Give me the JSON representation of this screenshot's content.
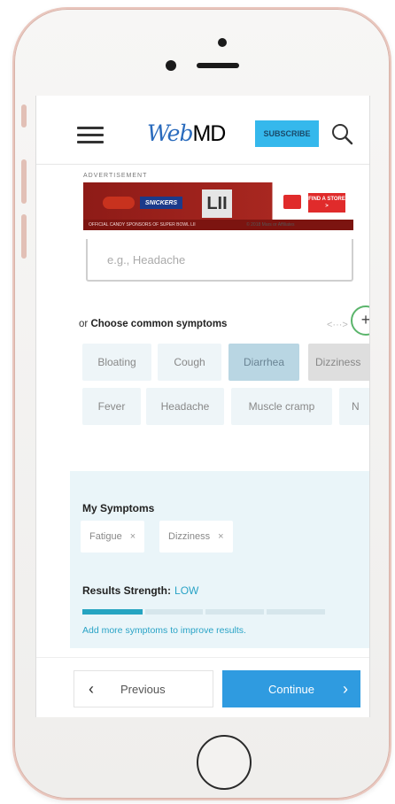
{
  "header": {
    "logo_web": "WebMD",
    "subscribe_label": "SUBSCRIBE"
  },
  "ad": {
    "label": "ADVERTISEMENT",
    "brand_text": "SNICKERS",
    "lii": "LII",
    "footer": "OFFICIAL CANDY SPONSORS OF SUPER BOWL LII",
    "copyright": "© 2018 Mars or Affiliates",
    "store_cta": "FIND A STORE >"
  },
  "search": {
    "placeholder": "e.g., Headache"
  },
  "common": {
    "prefix": "or",
    "title": "Choose common symptoms",
    "arrows": "<···>",
    "add_symbol": "+",
    "row1": [
      "Bloating",
      "Cough",
      "Diarrhea",
      "Dizziness"
    ],
    "row2": [
      "Fever",
      "Headache",
      "Muscle cramp",
      "N"
    ]
  },
  "my_symptoms": {
    "title": "My Symptoms",
    "tags": [
      "Fatigue",
      "Dizziness"
    ],
    "remove_symbol": "×",
    "strength_label": "Results Strength:",
    "strength_value": "LOW",
    "strength_level": 0.25,
    "hint": "Add more symptoms to improve results."
  },
  "nav": {
    "previous_label": "Previous",
    "continue_label": "Continue"
  },
  "colors": {
    "accent": "#2f9be0",
    "subscribe": "#35b8ec",
    "strength": "#26a4c1",
    "panel": "#eaf5f9"
  }
}
